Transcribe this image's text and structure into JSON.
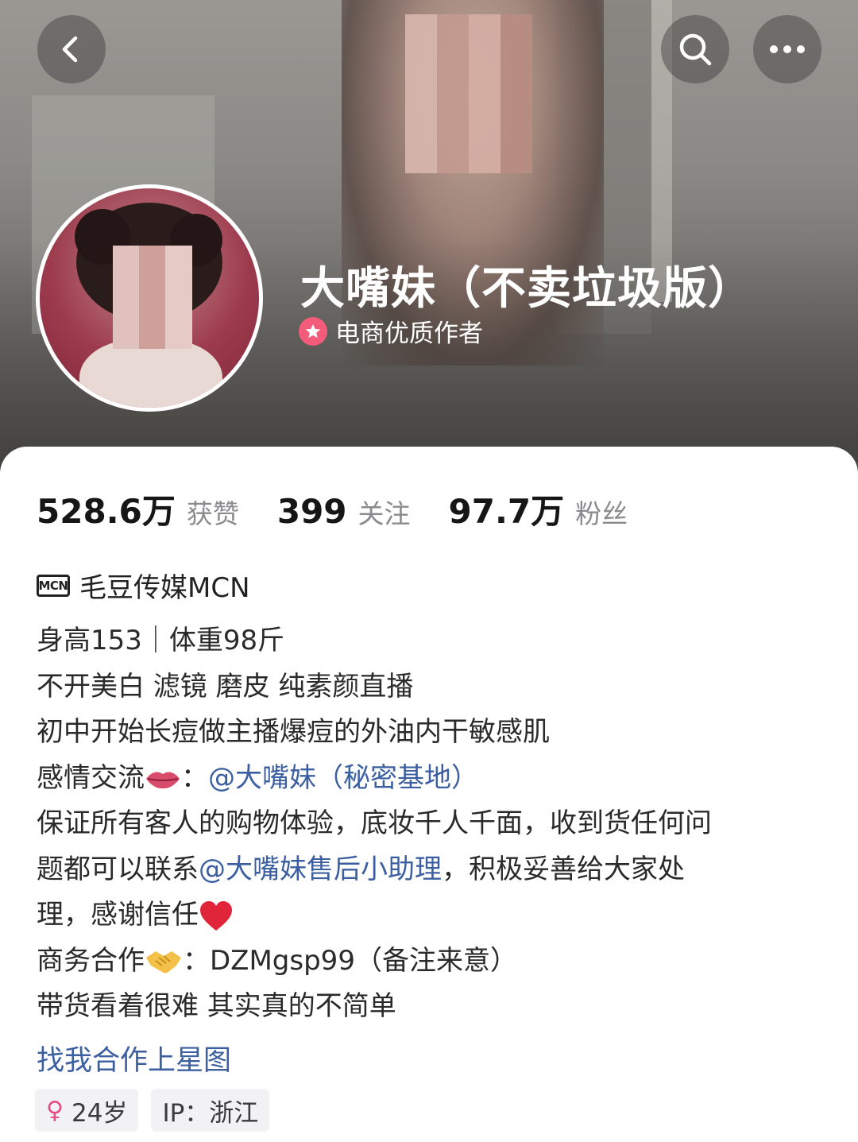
{
  "header": {
    "nickname": "大嘴妹（不卖垃圾版）",
    "badge_text": "电商优质作者"
  },
  "stats": [
    {
      "value": "528.6万",
      "label": "获赞"
    },
    {
      "value": "399",
      "label": "关注"
    },
    {
      "value": "97.7万",
      "label": "粉丝"
    }
  ],
  "mcn": {
    "icon_text": "MCN",
    "name": "毛豆传媒MCN"
  },
  "bio": {
    "line1": "身高153｜体重98斤",
    "line2": "不开美白 滤镜 磨皮 纯素颜直播",
    "line3": "初中开始长痘做主播爆痘的外油内干敏感肌",
    "line4_prefix": "感情交流",
    "line4_sep": "：",
    "line4_link": "@大嘴妹（秘密基地）",
    "line5": "保证所有客人的购物体验，底妆千人千面，收到货任何问",
    "line6_prefix": "题都可以联系",
    "line6_link": "@大嘴妹售后小助理",
    "line6_suffix": "，积极妥善给大家处",
    "line7": "理，感谢信任",
    "line8_prefix": "商务合作",
    "line8_suffix": "：DZMgsp99（备注来意）",
    "line9": "带货看着很难 其实真的不简单"
  },
  "star_link": "找我合作上星图",
  "tags": {
    "age": "24岁",
    "ip": "IP：浙江"
  },
  "icons": {
    "back": "chevron-left-icon",
    "search": "search-icon",
    "more": "more-icon",
    "badge": "star-badge-icon",
    "gender": "female-icon"
  },
  "colors": {
    "link": "#3b5fa0",
    "badge": "#f25b7a",
    "gender": "#e64b83"
  }
}
